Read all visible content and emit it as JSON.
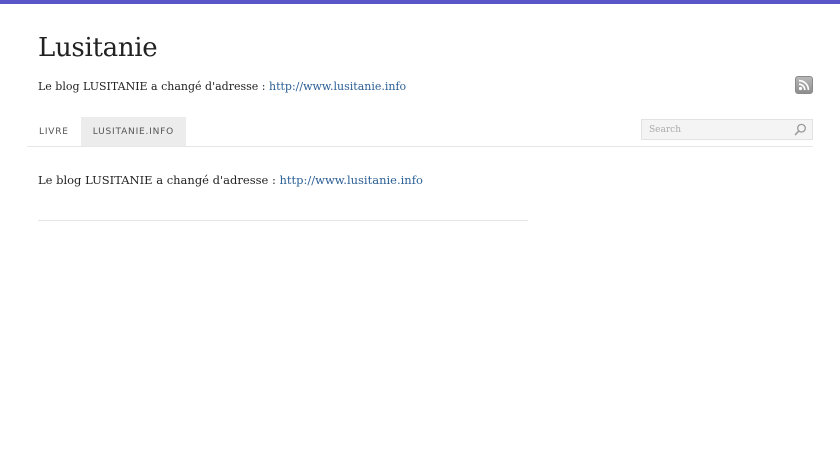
{
  "site": {
    "title": "Lusitanie",
    "tagline_text": "Le blog LUSITANIE a changé d'adresse : ",
    "tagline_link": "http://www.lusitanie.info"
  },
  "nav": {
    "items": [
      {
        "label": "LIVRE"
      },
      {
        "label": "LUSITANIE.INFO"
      }
    ]
  },
  "search": {
    "placeholder": "Search"
  },
  "post": {
    "text": "Le blog LUSITANIE a changé d'adresse : ",
    "link": "http://www.lusitanie.info"
  },
  "icons": {
    "rss": "rss-feed-icon",
    "search": "magnifier-icon"
  },
  "colors": {
    "top_bar": "#5a56c8",
    "link": "#2b5f95",
    "active_tab": "#ececec"
  }
}
